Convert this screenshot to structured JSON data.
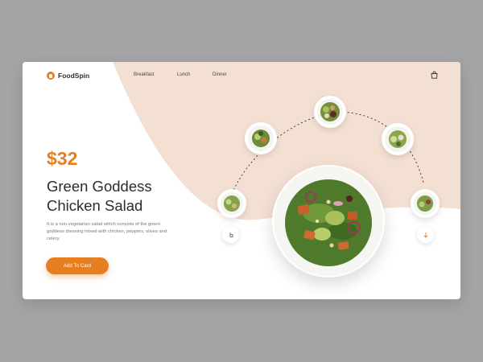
{
  "brand": {
    "name": "FoodSpin"
  },
  "nav": {
    "items": [
      {
        "label": "Breakfast"
      },
      {
        "label": "Lunch"
      },
      {
        "label": "Dinner"
      }
    ]
  },
  "hero": {
    "price": "$32",
    "title_line1": "Green Goddess",
    "title_line2": "Chicken Salad",
    "description": "It is a non vegetarian salad which consists of the green goddess dressing mixed with chicken, peppers, olives and celery.",
    "cta_label": "Add To Card"
  },
  "icons": {
    "logo": "chef-hat-icon",
    "cart": "shopping-bag-icon",
    "prev": "pointer-hand-icon",
    "next": "arrow-down-icon"
  },
  "colors": {
    "accent": "#e67e22",
    "arc_background": "#f4e0d3",
    "page_background": "#a4a4a6"
  }
}
